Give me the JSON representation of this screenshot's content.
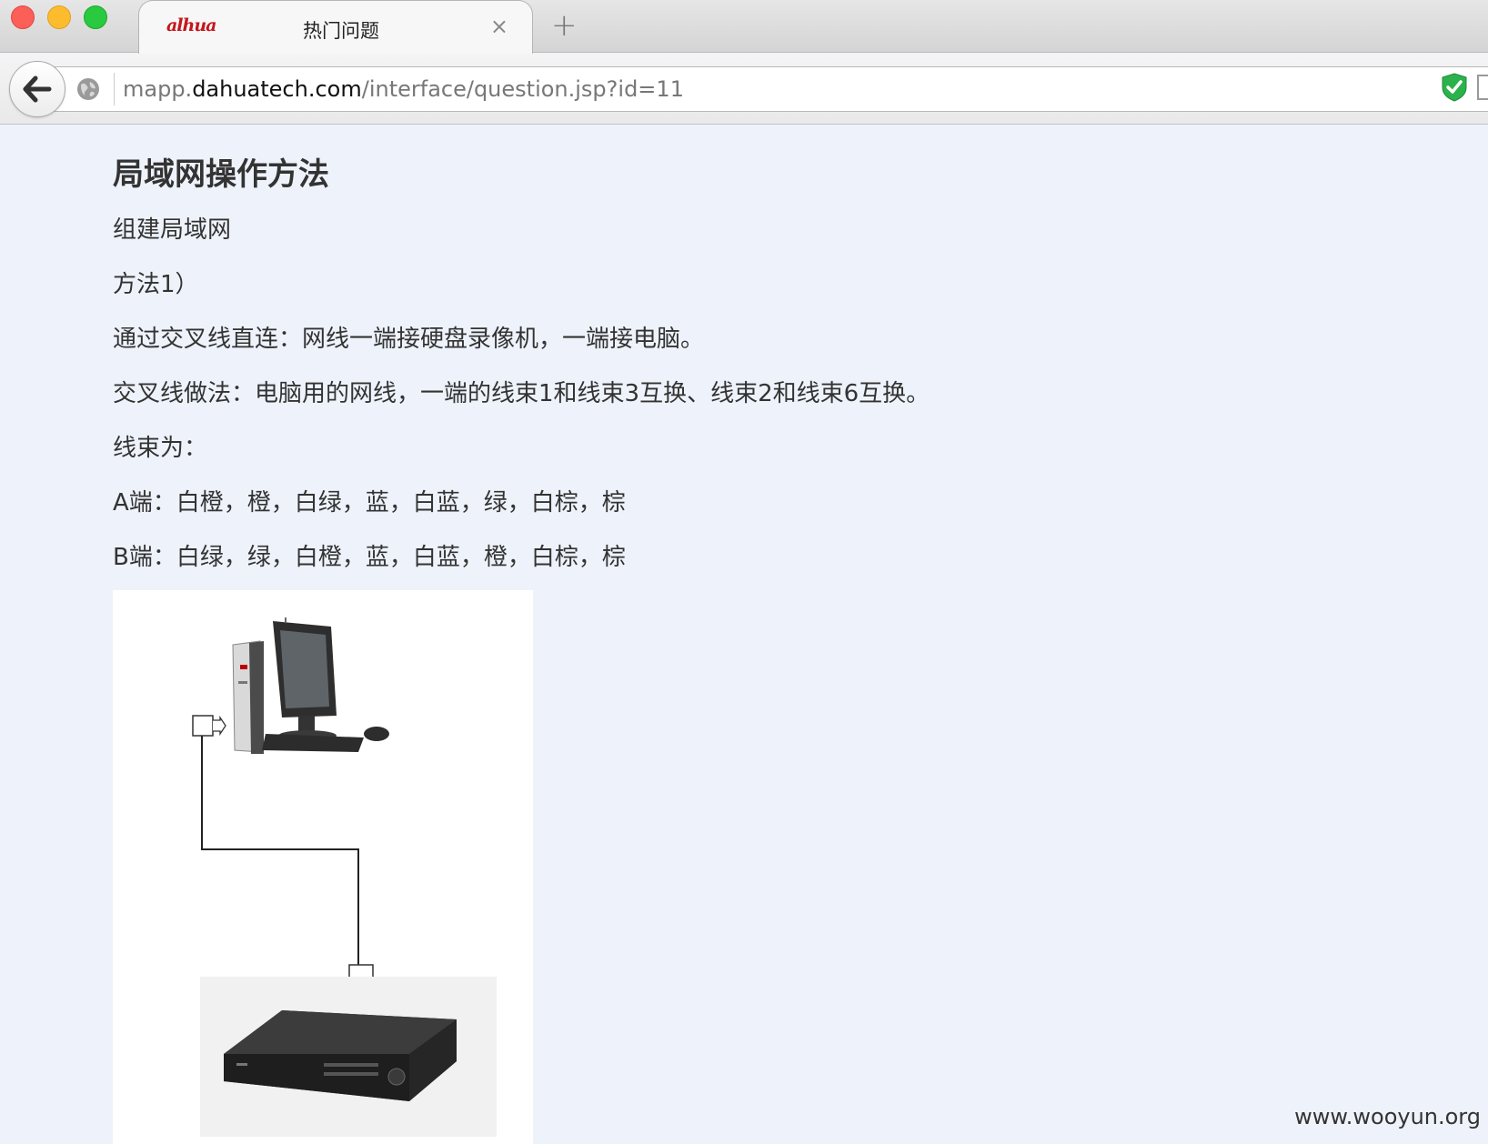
{
  "browser": {
    "tab": {
      "favicon_text": "alhua",
      "title": "热门问题",
      "close_glyph": "×"
    },
    "new_tab_glyph": "+",
    "url": {
      "scheme": "mapp.",
      "host": "dahuatech.com",
      "path": "/interface/question.jsp?id=11"
    },
    "icons": [
      "back-arrow-icon",
      "globe-icon",
      "shield-check-icon",
      "extension-icon"
    ]
  },
  "article": {
    "title": "局域网操作方法",
    "paragraphs": [
      "组建局域网",
      "方法1）",
      "通过交叉线直连：网线一端接硬盘录像机，一端接电脑。",
      "交叉线做法：电脑用的网线，一端的线束1和线束3互换、线束2和线束6互换。",
      "线束为：",
      "A端：白橙，橙，白绿，蓝，白蓝，绿，白棕，棕",
      "B端：白绿，绿，白橙，蓝，白蓝，橙，白棕，棕"
    ]
  },
  "colors": {
    "page_bg": "#eef3fb",
    "brand_red": "#c4161c",
    "shield_green": "#2bb24c"
  },
  "watermark": "www.wooyun.org"
}
